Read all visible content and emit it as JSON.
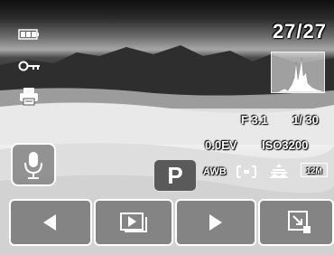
{
  "status": {
    "counter": "27/27",
    "aperture": "F 3.1",
    "shutter": "1/ 30",
    "exposure": "0.0EV",
    "iso": "ISO3200"
  },
  "mode": {
    "label": "P"
  },
  "icons": {
    "white_balance": "AWB",
    "megapixels": "12M",
    "left_icons": [
      "battery-icon",
      "protect-key-icon",
      "print-icon"
    ],
    "metering": "metering-icon",
    "macro": "focus-icon"
  },
  "toolbar": [
    "previous-arrow-icon",
    "playback-slideshow-icon",
    "next-arrow-icon",
    "zoom-resize-icon"
  ],
  "colors": {
    "button_bg": "#6e6e6e",
    "button_border": "#ffffff"
  }
}
